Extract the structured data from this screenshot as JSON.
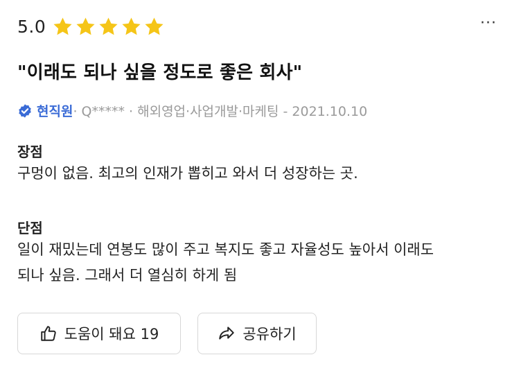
{
  "review": {
    "score": "5.0",
    "stars": 5,
    "title": "\"이래도 되나 싶을 정도로 좋은 회사\"",
    "author": {
      "badge": "현직원",
      "rest": " · Q***** · 해외영업·사업개발·마케팅 - 2021.10.10"
    },
    "pros": {
      "heading": "장점",
      "text": "구멍이 없음. 최고의 인재가 뽑히고 와서 더 성장하는 곳."
    },
    "cons": {
      "heading": "단점",
      "line1": "일이 재밌는데 연봉도 많이 주고 복지도 좋고 자율성도 높아서 이래도",
      "line2": "되나 싶음. 그래서 더 열심히 하게 됨"
    }
  },
  "actions": {
    "helpful_label": "도움이 돼요 19",
    "share_label": "공유하기"
  },
  "more_menu": "···",
  "colors": {
    "star": "#F5C518",
    "badge": "#3A6BD6"
  },
  "icons": [
    "star-icon",
    "verified-badge-icon",
    "thumbs-up-icon",
    "share-arrow-icon",
    "more-dots-icon"
  ]
}
